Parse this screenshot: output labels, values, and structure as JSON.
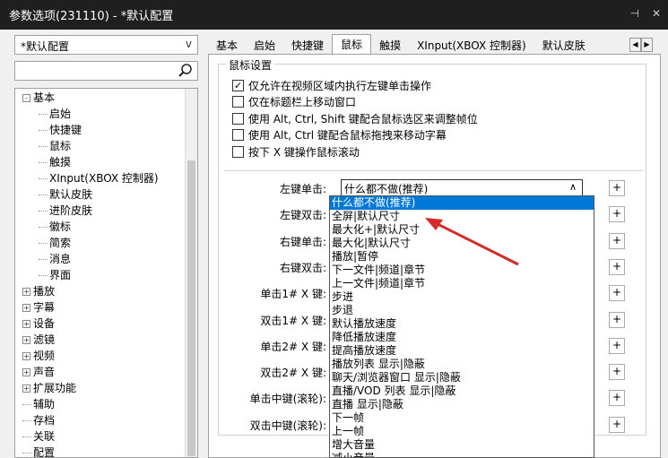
{
  "window": {
    "title": "参数选项(231110) - *默认配置",
    "pin_icon": "pin-icon",
    "close_icon": "close-icon"
  },
  "profile_select": {
    "value": "*默认配置",
    "arrow": "v"
  },
  "search": {
    "value": ""
  },
  "tree": {
    "items": [
      {
        "label": "基本",
        "expander": "-",
        "level": 0
      },
      {
        "label": "启始",
        "level": 1
      },
      {
        "label": "快捷键",
        "level": 1
      },
      {
        "label": "鼠标",
        "level": 1
      },
      {
        "label": "触摸",
        "level": 1
      },
      {
        "label": "XInput(XBOX 控制器)",
        "level": 1
      },
      {
        "label": "默认皮肤",
        "level": 1
      },
      {
        "label": "进阶皮肤",
        "level": 1
      },
      {
        "label": "徽标",
        "level": 1
      },
      {
        "label": "简索",
        "level": 1
      },
      {
        "label": "消息",
        "level": 1
      },
      {
        "label": "界面",
        "level": 1
      },
      {
        "label": "播放",
        "expander": "+",
        "level": 0
      },
      {
        "label": "字幕",
        "expander": "+",
        "level": 0
      },
      {
        "label": "设备",
        "expander": "+",
        "level": 0
      },
      {
        "label": "滤镜",
        "expander": "+",
        "level": 0
      },
      {
        "label": "视频",
        "expander": "+",
        "level": 0
      },
      {
        "label": "声音",
        "expander": "+",
        "level": 0
      },
      {
        "label": "扩展功能",
        "expander": "+",
        "level": 0
      },
      {
        "label": "辅助",
        "level": 0
      },
      {
        "label": "存档",
        "level": 0
      },
      {
        "label": "关联",
        "level": 0
      },
      {
        "label": "配置",
        "level": 0
      }
    ]
  },
  "tabs": [
    {
      "label": "基本"
    },
    {
      "label": "启始"
    },
    {
      "label": "快捷键"
    },
    {
      "label": "鼠标",
      "active": true
    },
    {
      "label": "触摸"
    },
    {
      "label": "XInput(XBOX 控制器)"
    },
    {
      "label": "默认皮肤"
    }
  ],
  "mouse": {
    "group_title": "鼠标设置",
    "checkboxes": [
      {
        "label": "仅允许在视频区域内执行左键单击操作",
        "checked": true
      },
      {
        "label": "仅在标题栏上移动窗口",
        "checked": false
      },
      {
        "label": "使用 Alt, Ctrl, Shift 键配合鼠标选区来调整帧位",
        "checked": false
      },
      {
        "label": "使用 Alt, Ctrl 键配合鼠标拖拽来移动字幕",
        "checked": false
      },
      {
        "label": "按下 X 键操作鼠标滚动",
        "checked": false
      }
    ],
    "rows": [
      {
        "label": "左键单击:",
        "value": "什么都不做(推荐)"
      },
      {
        "label": "左键双击:",
        "value": ""
      },
      {
        "label": "右键单击:",
        "value": ""
      },
      {
        "label": "右键双击:",
        "value": ""
      },
      {
        "label": "单击1# X 键:",
        "value": ""
      },
      {
        "label": "双击1# X 键:",
        "value": ""
      },
      {
        "label": "单击2# X 键:",
        "value": ""
      },
      {
        "label": "双击2# X 键:",
        "value": ""
      },
      {
        "label": "单击中键(滚轮):",
        "value": ""
      },
      {
        "label": "双击中键(滚轮):",
        "value": ""
      }
    ],
    "plus_label": "+"
  },
  "dropdown": {
    "items": [
      {
        "label": "什么都不做(推荐)",
        "selected": true
      },
      {
        "label": "全屏|默认尺寸"
      },
      {
        "label": "最大化+|默认尺寸"
      },
      {
        "label": "最大化|默认尺寸"
      },
      {
        "label": "播放|暂停"
      },
      {
        "label": "下一文件|频道|章节"
      },
      {
        "label": "上一文件|频道|章节"
      },
      {
        "label": "步进"
      },
      {
        "label": "步退"
      },
      {
        "label": "默认播放速度"
      },
      {
        "label": "降低播放速度"
      },
      {
        "label": "提高播放速度"
      },
      {
        "label": "播放列表 显示|隐蔽"
      },
      {
        "label": "聊天/浏览器窗口 显示|隐蔽"
      },
      {
        "label": "直播/VOD 列表 显示|隐蔽"
      },
      {
        "label": "直播 显示|隐蔽"
      },
      {
        "label": "下一帧"
      },
      {
        "label": "上一帧"
      },
      {
        "label": "增大音量"
      },
      {
        "label": "减小音量"
      }
    ]
  },
  "colors": {
    "accent": "#0078d7",
    "titlebar": "#1f1f1f",
    "annotation_arrow": "#d42a2a"
  }
}
